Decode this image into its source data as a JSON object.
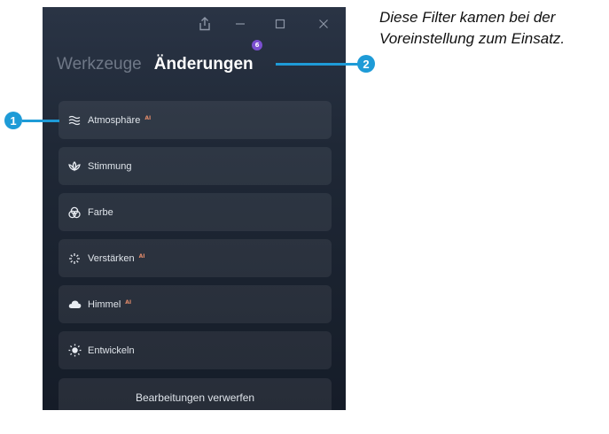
{
  "window": {
    "share_icon": "share-icon",
    "minimize_icon": "minimize-icon",
    "maximize_icon": "maximize-icon",
    "close_icon": "close-icon"
  },
  "tabs": {
    "inactive_label": "Werkzeuge",
    "active_label": "Änderungen",
    "badge_count": "6"
  },
  "menu": {
    "items": [
      {
        "label": "Atmosphäre",
        "icon": "waves-icon",
        "ai": "AI"
      },
      {
        "label": "Stimmung",
        "icon": "lotus-icon",
        "ai": ""
      },
      {
        "label": "Farbe",
        "icon": "color-circles-icon",
        "ai": ""
      },
      {
        "label": "Verstärken",
        "icon": "sparkle-icon",
        "ai": "AI"
      },
      {
        "label": "Himmel",
        "icon": "cloud-icon",
        "ai": "AI"
      },
      {
        "label": "Entwickeln",
        "icon": "sun-icon",
        "ai": ""
      }
    ],
    "discard_label": "Bearbeitungen verwerfen"
  },
  "callouts": {
    "one": "1",
    "two": "2",
    "color": "#1e9bd7"
  },
  "caption": {
    "line1": "Diese Filter kamen bei der",
    "line2": "Voreinstellung zum Einsatz."
  },
  "colors": {
    "panel_bg": "#1f2836",
    "badge": "#7b4fcf",
    "ai_tag": "#e08a6a"
  }
}
